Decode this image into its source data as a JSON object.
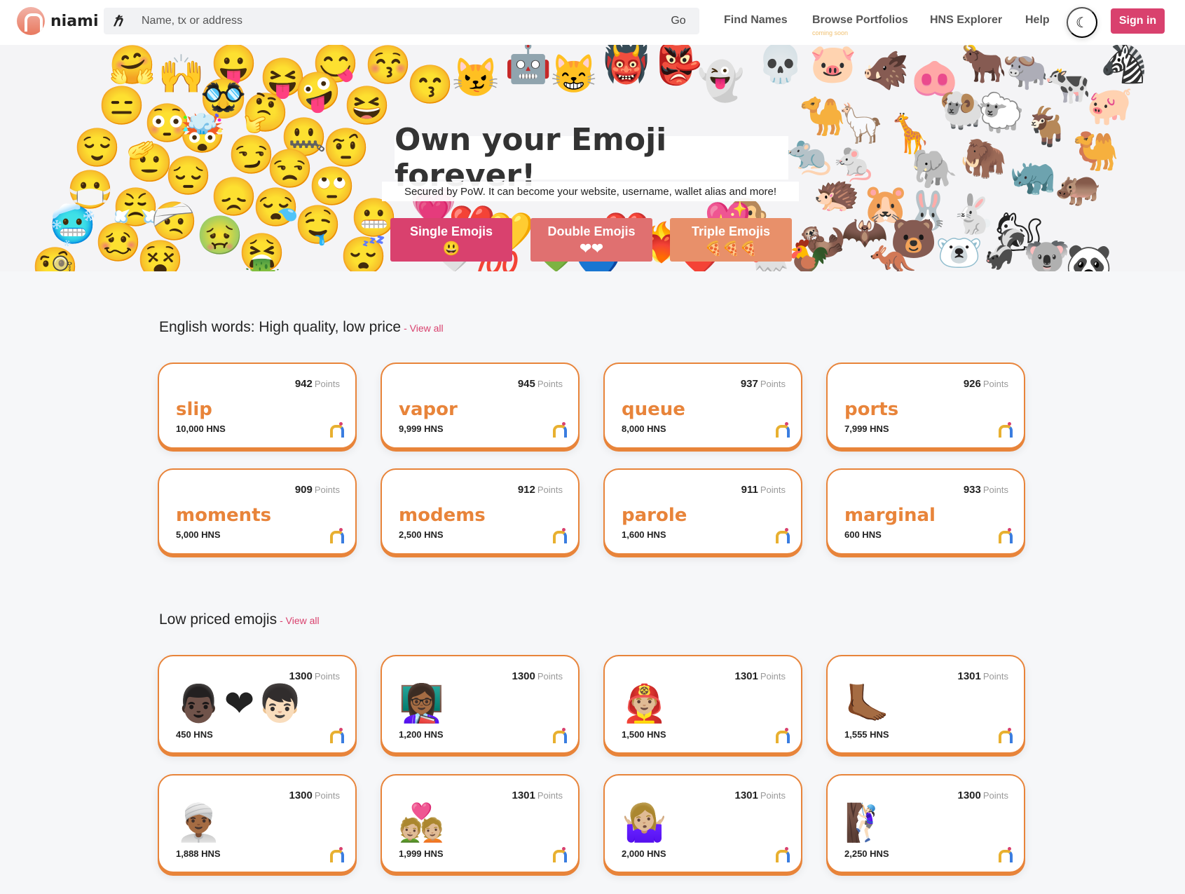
{
  "header": {
    "logo_text": "niami",
    "search_placeholder": "Name, tx or address",
    "go_label": "Go",
    "nav": [
      {
        "label": "Find Names"
      },
      {
        "label": "Browse Portfolios",
        "sub": "coming soon"
      },
      {
        "label": "HNS Explorer"
      },
      {
        "label": "Help"
      }
    ],
    "dark_mode_icon": "moon-icon",
    "signin_label": "Sign in"
  },
  "hero": {
    "title": "Own your Emoji forever!",
    "subtitle": "Secured by PoW. It can become your website, username, wallet alias and more!",
    "buttons": [
      {
        "label": "Single Emojis",
        "emoji": "😃",
        "color": "#d9416e"
      },
      {
        "label": "Double Emojis",
        "emoji": "❤❤",
        "color": "#e07070"
      },
      {
        "label": "Triple Emojis",
        "emoji": "🍕🍕🍕",
        "color": "#e8906a"
      }
    ]
  },
  "english_section": {
    "title": "English words: High quality, low price",
    "view_all": "- View all",
    "cards": [
      {
        "name": "slip",
        "points": "942",
        "points_label": "Points",
        "price": "10,000 HNS"
      },
      {
        "name": "vapor",
        "points": "945",
        "points_label": "Points",
        "price": "9,999 HNS"
      },
      {
        "name": "queue",
        "points": "937",
        "points_label": "Points",
        "price": "8,000 HNS"
      },
      {
        "name": "ports",
        "points": "926",
        "points_label": "Points",
        "price": "7,999 HNS"
      },
      {
        "name": "moments",
        "points": "909",
        "points_label": "Points",
        "price": "5,000 HNS"
      },
      {
        "name": "modems",
        "points": "912",
        "points_label": "Points",
        "price": "2,500 HNS"
      },
      {
        "name": "parole",
        "points": "911",
        "points_label": "Points",
        "price": "1,600 HNS"
      },
      {
        "name": "marginal",
        "points": "933",
        "points_label": "Points",
        "price": "600 HNS"
      }
    ]
  },
  "emoji_section": {
    "title": "Low priced emojis",
    "view_all": "- View all",
    "cards": [
      {
        "emoji": "👨🏿❤👦🏻",
        "points": "1300",
        "points_label": "Points",
        "price": "450 HNS"
      },
      {
        "emoji": "👩🏾‍🏫",
        "points": "1300",
        "points_label": "Points",
        "price": "1,200 HNS"
      },
      {
        "emoji": "👨🏼‍🚒",
        "points": "1301",
        "points_label": "Points",
        "price": "1,500 HNS"
      },
      {
        "emoji": "🦶🏾",
        "points": "1301",
        "points_label": "Points",
        "price": "1,555 HNS"
      },
      {
        "emoji": "👳🏾‍♂️",
        "points": "1300",
        "points_label": "Points",
        "price": "1,888 HNS"
      },
      {
        "emoji": "💑🏼",
        "points": "1301",
        "points_label": "Points",
        "price": "1,999 HNS"
      },
      {
        "emoji": "🤷🏼‍♀️",
        "points": "1301",
        "points_label": "Points",
        "price": "2,000 HNS"
      },
      {
        "emoji": "🧗🏻‍♀️",
        "points": "1300",
        "points_label": "Points",
        "price": "2,250 HNS"
      }
    ]
  },
  "colors": {
    "accent": "#d9416e",
    "card_border": "#e8843a",
    "name_text": "#e8843a"
  }
}
